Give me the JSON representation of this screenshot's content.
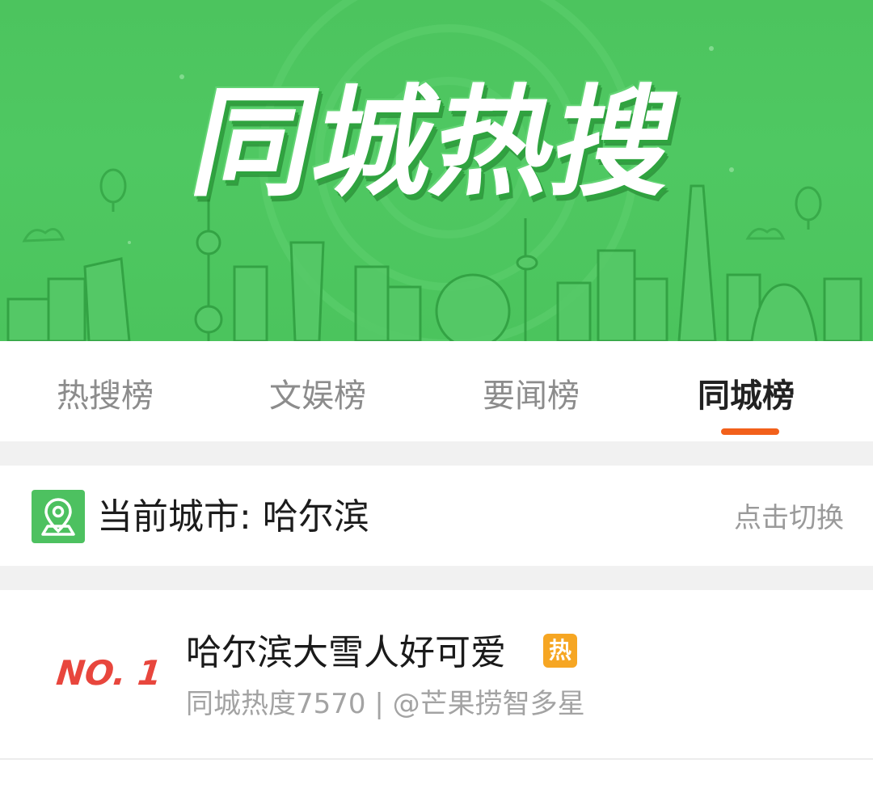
{
  "banner": {
    "title": "同城热搜"
  },
  "tabs": [
    {
      "label": "热搜榜",
      "active": false
    },
    {
      "label": "文娱榜",
      "active": false
    },
    {
      "label": "要闻榜",
      "active": false
    },
    {
      "label": "同城榜",
      "active": true
    }
  ],
  "city": {
    "label": "当前城市: 哈尔滨",
    "switch_label": "点击切换",
    "icon": "location-pin-icon"
  },
  "items": [
    {
      "rank": "NO. 1",
      "title": "哈尔滨大雪人好可爱",
      "badge": "热",
      "meta": "同城热度7570 | @芒果捞智多星"
    }
  ],
  "colors": {
    "banner_green": "#4cc45e",
    "accent_orange": "#f2601b",
    "rank_red": "#e8463d",
    "hot_badge": "#f6a623"
  }
}
